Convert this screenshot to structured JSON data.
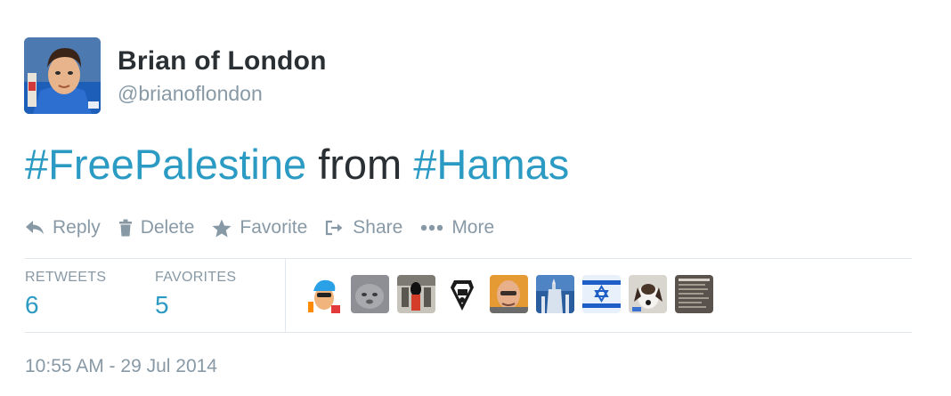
{
  "user": {
    "display_name": "Brian of London",
    "handle": "@brianoflondon"
  },
  "tweet": {
    "parts": [
      {
        "text": "#FreePalestine",
        "type": "hashtag"
      },
      {
        "text": " from ",
        "type": "text"
      },
      {
        "text": "#Hamas",
        "type": "hashtag"
      }
    ]
  },
  "actions": {
    "reply": "Reply",
    "delete": "Delete",
    "favorite": "Favorite",
    "share": "Share",
    "more": "More"
  },
  "stats": {
    "retweets_label": "RETWEETS",
    "retweets_value": "6",
    "favorites_label": "FAVORITES",
    "favorites_value": "5"
  },
  "favoriter_avatars": [
    {
      "icon": "avatar-cartoon-blue-hair-icon"
    },
    {
      "icon": "avatar-cat-icon"
    },
    {
      "icon": "avatar-guard-icon"
    },
    {
      "icon": "avatar-emblem-icon"
    },
    {
      "icon": "avatar-bald-man-icon"
    },
    {
      "icon": "avatar-statue-liberty-icon"
    },
    {
      "icon": "avatar-israel-flag-icon"
    },
    {
      "icon": "avatar-dog-icon"
    },
    {
      "icon": "avatar-text-card-icon"
    }
  ],
  "timestamp": "10:55 AM - 29 Jul 2014",
  "colors": {
    "link": "#2b9bc4",
    "text": "#292f33",
    "muted": "#8899a6",
    "border": "#e1e8ed"
  }
}
